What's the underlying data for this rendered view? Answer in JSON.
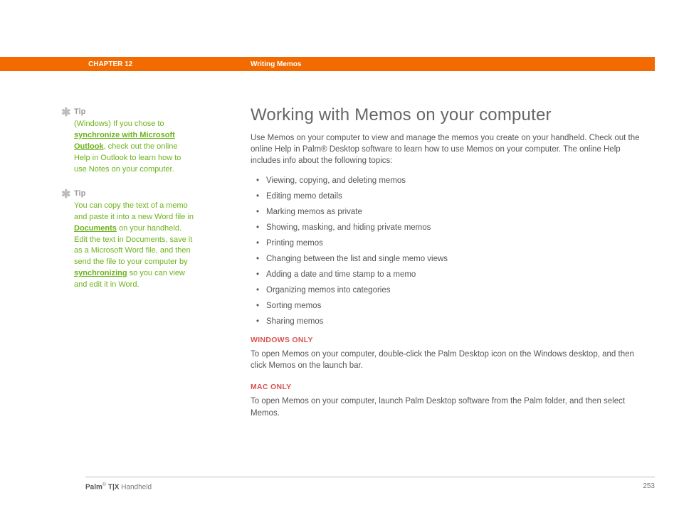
{
  "header": {
    "chapter": "CHAPTER 12",
    "section": "Writing Memos"
  },
  "tips": [
    {
      "label": "Tip",
      "pre": "(Windows) If you chose to ",
      "link1": "synchronize with Microsoft Outlook",
      "post": ", check out the online Help in Outlook to learn how to use Notes on your computer."
    },
    {
      "label": "Tip",
      "t1": "You can copy the text of a memo and paste it into a new Word file in ",
      "link1": "Documents",
      "t2": " on your handheld. Edit the text in Documents, save it as a Microsoft Word file, and then send the file to your computer by ",
      "link2": "synchronizing",
      "t3": " so you can view and edit it in Word."
    }
  ],
  "main": {
    "title": "Working with Memos on your computer",
    "intro": "Use Memos on your computer to view and manage the memos you create on your handheld. Check out the online Help in Palm® Desktop software to learn how to use Memos on your computer. The online Help includes info about the following topics:",
    "bullets": [
      "Viewing, copying, and deleting memos",
      "Editing memo details",
      "Marking memos as private",
      "Showing, masking, and hiding private memos",
      "Printing memos",
      "Changing between the list and single memo views",
      "Adding a date and time stamp to a memo",
      "Organizing memos into categories",
      "Sorting memos",
      "Sharing memos"
    ],
    "win_head": "WINDOWS ONLY",
    "win_body": "To open Memos on your computer, double-click the Palm Desktop icon on the Windows desktop, and then click Memos on the launch bar.",
    "mac_head": "MAC ONLY",
    "mac_body": "To open Memos on your computer, launch Palm Desktop software from the Palm folder, and then select Memos."
  },
  "footer": {
    "product_bold": "Palm",
    "product_reg": "®",
    "product_mid": " T|X",
    "product_tail": " Handheld",
    "page": "253"
  }
}
